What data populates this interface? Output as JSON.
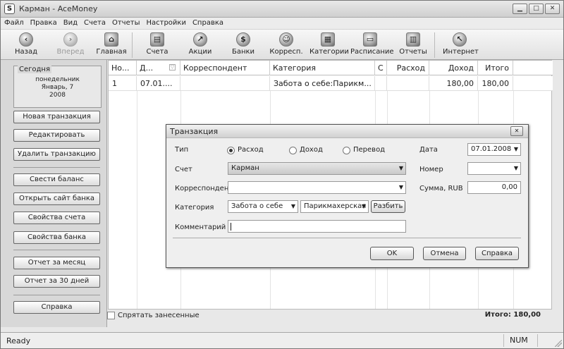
{
  "window": {
    "title": "Карман - AceMoney",
    "app_icon": "S"
  },
  "menu": [
    "Файл",
    "Правка",
    "Вид",
    "Счета",
    "Отчеты",
    "Настройки",
    "Справка"
  ],
  "toolbar": {
    "back": "Назад",
    "forward": "Вперед",
    "home": "Главная",
    "accounts": "Счета",
    "stocks": "Акции",
    "banks": "Банки",
    "payees": "Корресп.",
    "categories": "Категории",
    "schedule": "Расписание",
    "reports": "Отчеты",
    "internet": "Интернет"
  },
  "sidebar": {
    "today_title": "Сегодня",
    "today_weekday": "понедельник",
    "today_date": "Январь, 7",
    "today_year": "2008",
    "buttons": [
      "Новая транзакция",
      "Редактировать",
      "Удалить транзакцию",
      "Свести баланс",
      "Открыть сайт банка",
      "Свойства счета",
      "Свойства банка",
      "Отчет за месяц",
      "Отчет за 30 дней",
      "Справка"
    ]
  },
  "grid": {
    "columns": [
      "Но...",
      "Д...",
      "Корреспондент",
      "Категория",
      "С",
      "Расход",
      "Доход",
      "Итого"
    ],
    "rows": [
      {
        "num": "1",
        "date": "07.01....",
        "payee": "",
        "category": "Забота о себе:Парикм...",
        "c": "",
        "expense": "",
        "income": "180,00",
        "total": "180,00"
      }
    ]
  },
  "bottom": {
    "hide_label": "Спрятать занесенные",
    "total": "Итого: 180,00"
  },
  "status": {
    "ready": "Ready",
    "num": "NUM"
  },
  "dialog": {
    "title": "Транзакция",
    "type_label": "Тип",
    "types": [
      "Расход",
      "Доход",
      "Перевод"
    ],
    "account_label": "Счет",
    "account_value": "Карман",
    "payee_label": "Корреспондент",
    "payee_value": "",
    "category_label": "Категория",
    "category_value": "Забота о себе",
    "subcategory_value": "Парикмахерская",
    "split_button": "Разбить",
    "comment_label": "Комментарий",
    "comment_value": "",
    "date_label": "Дата",
    "date_value": "07.01.2008",
    "number_label": "Номер",
    "number_value": "",
    "amount_label": "Сумма, RUB",
    "amount_value": "0,00",
    "ok": "OK",
    "cancel": "Отмена",
    "help": "Справка"
  }
}
